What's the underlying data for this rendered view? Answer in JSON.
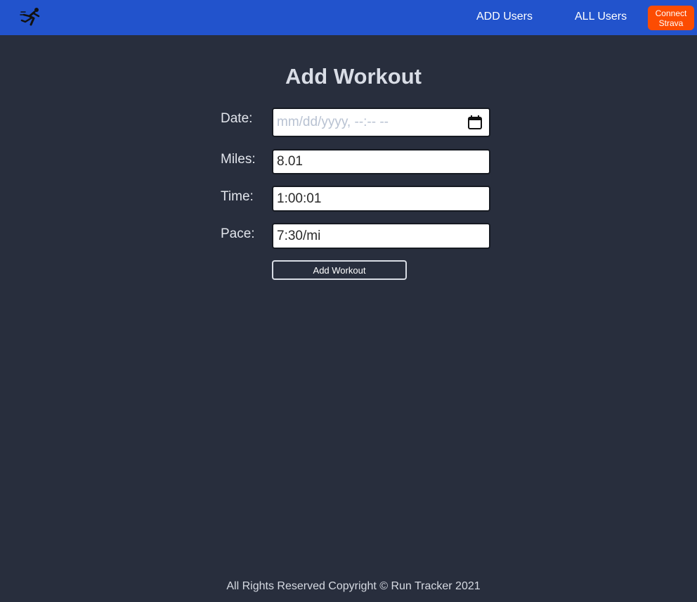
{
  "navbar": {
    "logo_icon": "runner-icon",
    "add_users_label": "ADD Users",
    "all_users_label": "ALL Users",
    "connect_strava_line1": "Connect",
    "connect_strava_line2": "Strava"
  },
  "form": {
    "title": "Add Workout",
    "date_label": "Date:",
    "date_placeholder": "mm/dd/yyyy, --:-- --",
    "date_value": "",
    "miles_label": "Miles:",
    "miles_value": "8.01",
    "time_label": "Time:",
    "time_value": "1:00:01",
    "pace_label": "Pace:",
    "pace_value": "7:30/mi",
    "submit_label": "Add Workout"
  },
  "footer": {
    "text": "All Rights Reserved Copyright © Run Tracker 2021"
  },
  "colors": {
    "navbar_bg": "#2253cc",
    "page_bg": "#282e3d",
    "strava_orange": "#fc4c02"
  }
}
